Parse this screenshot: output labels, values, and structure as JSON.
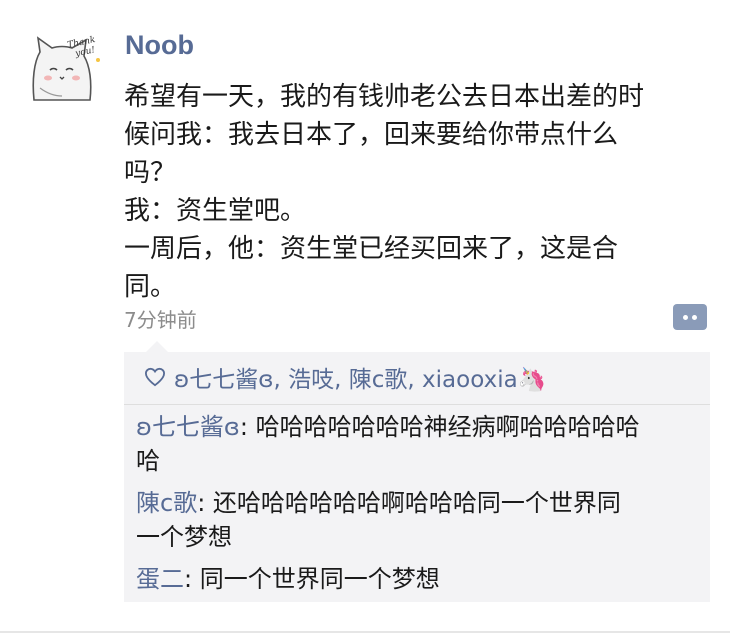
{
  "post": {
    "author": "Noob",
    "avatar_icon": "thank-you-cat-icon",
    "avatar_caption": "Thank you!",
    "lines": [
      "希望有一天，我的有钱帅老公去日本出差的时",
      "候问我：我去日本了，回来要给你带点什么",
      "吗？",
      "我：资生堂吧。",
      "一周后，他：资生堂已经买回来了，这是合",
      "同。"
    ],
    "time": "7分钟前",
    "more_icon": "more-dots-icon"
  },
  "likes": {
    "icon": "heart-outline-icon",
    "names": "ʚ七七酱ɞ, 浩吱, 陳c歌, xiaooxia🦄"
  },
  "comments": [
    {
      "nick": "ʚ七七酱ɞ",
      "sep": ": ",
      "first": "哈哈哈哈哈哈哈神经病啊哈哈哈哈哈",
      "rest": "哈"
    },
    {
      "nick": "陳c歌",
      "sep": ": ",
      "first": "还哈哈哈哈哈哈啊哈哈哈同一个世界同",
      "rest": "一个梦想"
    },
    {
      "nick": "蛋二",
      "sep": ": ",
      "first": "同一个世界同一个梦想",
      "rest": ""
    }
  ],
  "colors": {
    "link": "#576b95",
    "comment_bg": "#f3f3f5",
    "more_button": "#8a9bb8"
  }
}
